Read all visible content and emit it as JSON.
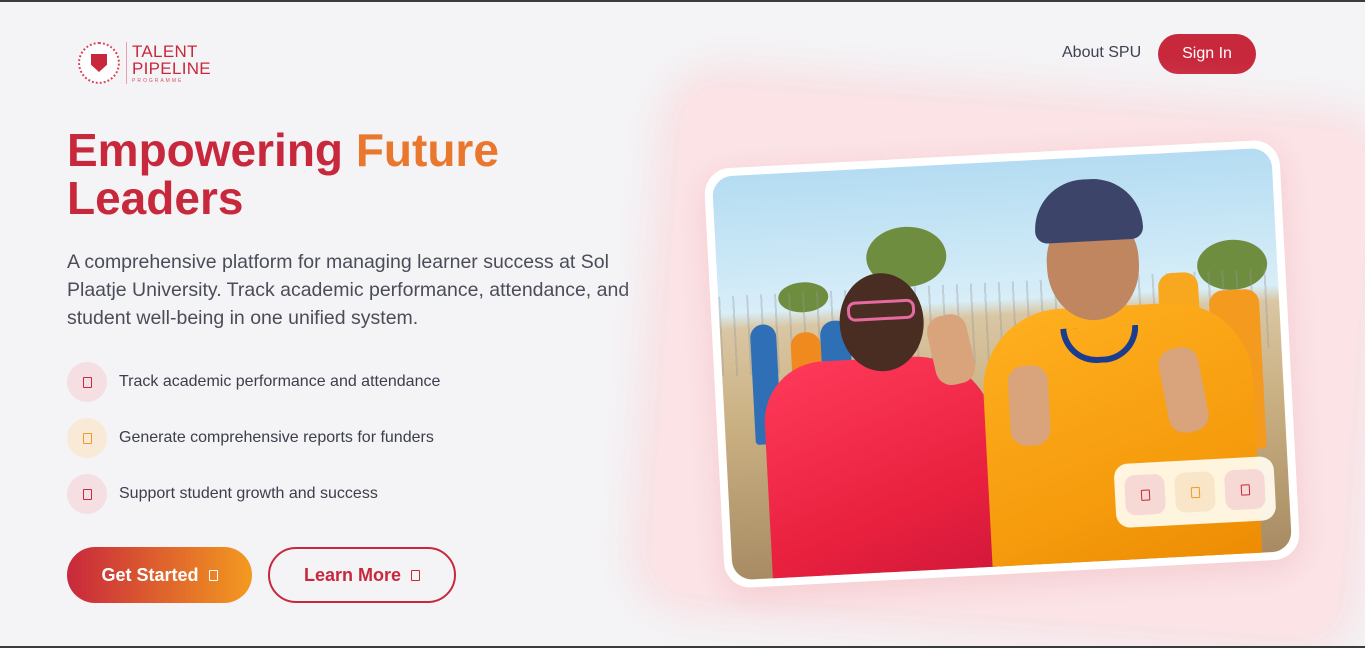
{
  "brand": {
    "name_line1": "TALENT",
    "name_line2": "PIPELINE",
    "name_line3": "PROGRAMME",
    "seal_icon": "university-seal-icon",
    "primary_color": "#c8283c",
    "accent_color": "#f39a1f"
  },
  "nav": {
    "about_label": "About SPU",
    "signin_label": "Sign In"
  },
  "hero": {
    "title_word1": "Empowering",
    "title_word2": "Future",
    "title_word3": "Leaders",
    "description": "A comprehensive platform for managing learner success at Sol Plaatje University. Track academic performance, attendance, and student well-being in one unified system.",
    "features": [
      {
        "icon": "chart-icon",
        "text": "Track academic performance and attendance"
      },
      {
        "icon": "report-icon",
        "text": "Generate comprehensive reports for funders"
      },
      {
        "icon": "growth-icon",
        "text": "Support student growth and success"
      }
    ],
    "get_started_label": "Get Started",
    "learn_more_label": "Learn More"
  },
  "photo": {
    "subject": "Two students in red and orange Talent Pipeline jackets making peace signs outdoors",
    "badge_icons": [
      "chart-icon",
      "report-icon",
      "growth-icon"
    ]
  }
}
